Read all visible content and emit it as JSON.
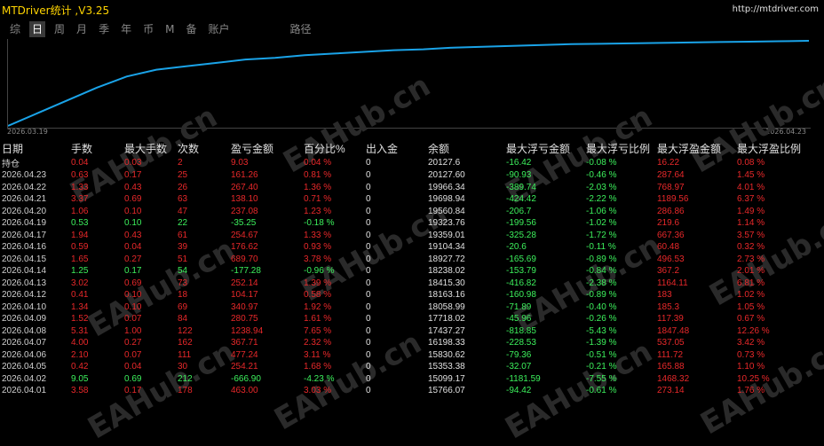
{
  "window": {
    "title": "MTDriver统计 ,V3.25",
    "url": "http://mtdriver.com"
  },
  "tabs": [
    {
      "label": "综",
      "active": false
    },
    {
      "label": "日",
      "active": true
    },
    {
      "label": "周",
      "active": false
    },
    {
      "label": "月",
      "active": false
    },
    {
      "label": "季",
      "active": false
    },
    {
      "label": "年",
      "active": false
    },
    {
      "label": "币",
      "active": false
    },
    {
      "label": "M",
      "active": false
    },
    {
      "label": "备",
      "active": false
    },
    {
      "label": "账户",
      "active": false
    },
    {
      "label": "路径",
      "active": false
    }
  ],
  "chart": {
    "start_date": "2026.03.19",
    "end_date": "2026.04.23",
    "line_color": "#1aa3e8",
    "values": [
      0,
      0.15,
      0.3,
      0.45,
      0.58,
      0.66,
      0.7,
      0.74,
      0.78,
      0.8,
      0.83,
      0.85,
      0.87,
      0.89,
      0.9,
      0.92,
      0.93,
      0.94,
      0.95,
      0.96,
      0.965,
      0.97,
      0.975,
      0.98,
      0.985,
      0.99,
      0.995,
      1.0
    ]
  },
  "watermark": "EAHub.cn",
  "table": {
    "headers": [
      "日期",
      "手数",
      "最大手数",
      "次数",
      "盈亏金额",
      "百分比%",
      "出入金",
      "余额",
      "最大浮亏金额",
      "最大浮亏比例",
      "最大浮盈金额",
      "最大浮盈比例"
    ],
    "position_row": {
      "label": "持仓",
      "lots": "0.04",
      "max_lots": "0.03",
      "count": "2",
      "pnl": "9.03",
      "pct": "0.04 %",
      "io": "0",
      "balance": "20127.6",
      "max_dd": "-16.42",
      "max_dd_pct": "-0.08 %",
      "max_fp": "16.22",
      "max_fp_pct": "0.08 %",
      "sign": "red"
    },
    "rows": [
      {
        "date": "2026.04.23",
        "lots": "0.63",
        "max_lots": "0.17",
        "count": "25",
        "pnl": "161.26",
        "pct": "0.81 %",
        "io": "0",
        "balance": "20127.60",
        "max_dd": "-90.93",
        "max_dd_pct": "-0.46 %",
        "max_fp": "287.64",
        "max_fp_pct": "1.45 %",
        "sign": "red"
      },
      {
        "date": "2026.04.22",
        "lots": "1.33",
        "max_lots": "0.43",
        "count": "26",
        "pnl": "267.40",
        "pct": "1.36 %",
        "io": "0",
        "balance": "19966.34",
        "max_dd": "-389.74",
        "max_dd_pct": "-2.03 %",
        "max_fp": "768.97",
        "max_fp_pct": "4.01 %",
        "sign": "red"
      },
      {
        "date": "2026.04.21",
        "lots": "3.37",
        "max_lots": "0.69",
        "count": "63",
        "pnl": "138.10",
        "pct": "0.71 %",
        "io": "0",
        "balance": "19698.94",
        "max_dd": "-424.42",
        "max_dd_pct": "-2.22 %",
        "max_fp": "1189.56",
        "max_fp_pct": "6.37 %",
        "sign": "red"
      },
      {
        "date": "2026.04.20",
        "lots": "1.06",
        "max_lots": "0.10",
        "count": "47",
        "pnl": "237.08",
        "pct": "1.23 %",
        "io": "0",
        "balance": "19560.84",
        "max_dd": "-206.7",
        "max_dd_pct": "-1.06 %",
        "max_fp": "286.86",
        "max_fp_pct": "1.49 %",
        "sign": "red"
      },
      {
        "date": "2026.04.19",
        "lots": "0.53",
        "max_lots": "0.10",
        "count": "22",
        "pnl": "-35.25",
        "pct": "-0.18 %",
        "io": "0",
        "balance": "19323.76",
        "max_dd": "-199.56",
        "max_dd_pct": "-1.02 %",
        "max_fp": "219.6",
        "max_fp_pct": "1.14 %",
        "sign": "green"
      },
      {
        "date": "2026.04.17",
        "lots": "1.94",
        "max_lots": "0.43",
        "count": "61",
        "pnl": "254.67",
        "pct": "1.33 %",
        "io": "0",
        "balance": "19359.01",
        "max_dd": "-325.28",
        "max_dd_pct": "-1.72 %",
        "max_fp": "667.36",
        "max_fp_pct": "3.57 %",
        "sign": "red"
      },
      {
        "date": "2026.04.16",
        "lots": "0.59",
        "max_lots": "0.04",
        "count": "39",
        "pnl": "176.62",
        "pct": "0.93 %",
        "io": "0",
        "balance": "19104.34",
        "max_dd": "-20.6",
        "max_dd_pct": "-0.11 %",
        "max_fp": "60.48",
        "max_fp_pct": "0.32 %",
        "sign": "red"
      },
      {
        "date": "2026.04.15",
        "lots": "1.65",
        "max_lots": "0.27",
        "count": "51",
        "pnl": "689.70",
        "pct": "3.78 %",
        "io": "0",
        "balance": "18927.72",
        "max_dd": "-165.69",
        "max_dd_pct": "-0.89 %",
        "max_fp": "496.53",
        "max_fp_pct": "2.73 %",
        "sign": "red"
      },
      {
        "date": "2026.04.14",
        "lots": "1.25",
        "max_lots": "0.17",
        "count": "54",
        "pnl": "-177.28",
        "pct": "-0.96 %",
        "io": "0",
        "balance": "18238.02",
        "max_dd": "-153.79",
        "max_dd_pct": "-0.84 %",
        "max_fp": "367.2",
        "max_fp_pct": "2.01 %",
        "sign": "green"
      },
      {
        "date": "2026.04.13",
        "lots": "3.02",
        "max_lots": "0.69",
        "count": "73",
        "pnl": "252.14",
        "pct": "1.39 %",
        "io": "0",
        "balance": "18415.30",
        "max_dd": "-416.82",
        "max_dd_pct": "-2.38 %",
        "max_fp": "1164.11",
        "max_fp_pct": "6.81 %",
        "sign": "red"
      },
      {
        "date": "2026.04.12",
        "lots": "0.41",
        "max_lots": "0.10",
        "count": "18",
        "pnl": "104.17",
        "pct": "0.58 %",
        "io": "0",
        "balance": "18163.16",
        "max_dd": "-160.98",
        "max_dd_pct": "-0.89 %",
        "max_fp": "183",
        "max_fp_pct": "1.02 %",
        "sign": "red"
      },
      {
        "date": "2026.04.10",
        "lots": "1.34",
        "max_lots": "0.10",
        "count": "69",
        "pnl": "340.97",
        "pct": "1.92 %",
        "io": "0",
        "balance": "18058.99",
        "max_dd": "-71.89",
        "max_dd_pct": "-0.40 %",
        "max_fp": "185.3",
        "max_fp_pct": "1.05 %",
        "sign": "red"
      },
      {
        "date": "2026.04.09",
        "lots": "1.52",
        "max_lots": "0.07",
        "count": "84",
        "pnl": "280.75",
        "pct": "1.61 %",
        "io": "0",
        "balance": "17718.02",
        "max_dd": "-45.96",
        "max_dd_pct": "-0.26 %",
        "max_fp": "117.39",
        "max_fp_pct": "0.67 %",
        "sign": "red"
      },
      {
        "date": "2026.04.08",
        "lots": "5.31",
        "max_lots": "1.00",
        "count": "122",
        "pnl": "1238.94",
        "pct": "7.65 %",
        "io": "0",
        "balance": "17437.27",
        "max_dd": "-818.85",
        "max_dd_pct": "-5.43 %",
        "max_fp": "1847.48",
        "max_fp_pct": "12.26 %",
        "sign": "red"
      },
      {
        "date": "2026.04.07",
        "lots": "4.00",
        "max_lots": "0.27",
        "count": "162",
        "pnl": "367.71",
        "pct": "2.32 %",
        "io": "0",
        "balance": "16198.33",
        "max_dd": "-228.53",
        "max_dd_pct": "-1.39 %",
        "max_fp": "537.05",
        "max_fp_pct": "3.42 %",
        "sign": "red"
      },
      {
        "date": "2026.04.06",
        "lots": "2.10",
        "max_lots": "0.07",
        "count": "111",
        "pnl": "477.24",
        "pct": "3.11 %",
        "io": "0",
        "balance": "15830.62",
        "max_dd": "-79.36",
        "max_dd_pct": "-0.51 %",
        "max_fp": "111.72",
        "max_fp_pct": "0.73 %",
        "sign": "red"
      },
      {
        "date": "2026.04.05",
        "lots": "0.42",
        "max_lots": "0.04",
        "count": "30",
        "pnl": "254.21",
        "pct": "1.68 %",
        "io": "0",
        "balance": "15353.38",
        "max_dd": "-32.07",
        "max_dd_pct": "-0.21 %",
        "max_fp": "165.88",
        "max_fp_pct": "1.10 %",
        "sign": "red"
      },
      {
        "date": "2026.04.02",
        "lots": "9.05",
        "max_lots": "0.69",
        "count": "212",
        "pnl": "-666.90",
        "pct": "-4.23 %",
        "io": "0",
        "balance": "15099.17",
        "max_dd": "-1181.59",
        "max_dd_pct": "-7.55 %",
        "max_fp": "1468.32",
        "max_fp_pct": "10.25 %",
        "sign": "green"
      },
      {
        "date": "2026.04.01",
        "lots": "3.58",
        "max_lots": "0.17",
        "count": "178",
        "pnl": "463.00",
        "pct": "3.03 %",
        "io": "0",
        "balance": "15766.07",
        "max_dd": "-94.42",
        "max_dd_pct": "-0.61 %",
        "max_fp": "273.14",
        "max_fp_pct": "1.76 %",
        "sign": "red"
      }
    ]
  }
}
